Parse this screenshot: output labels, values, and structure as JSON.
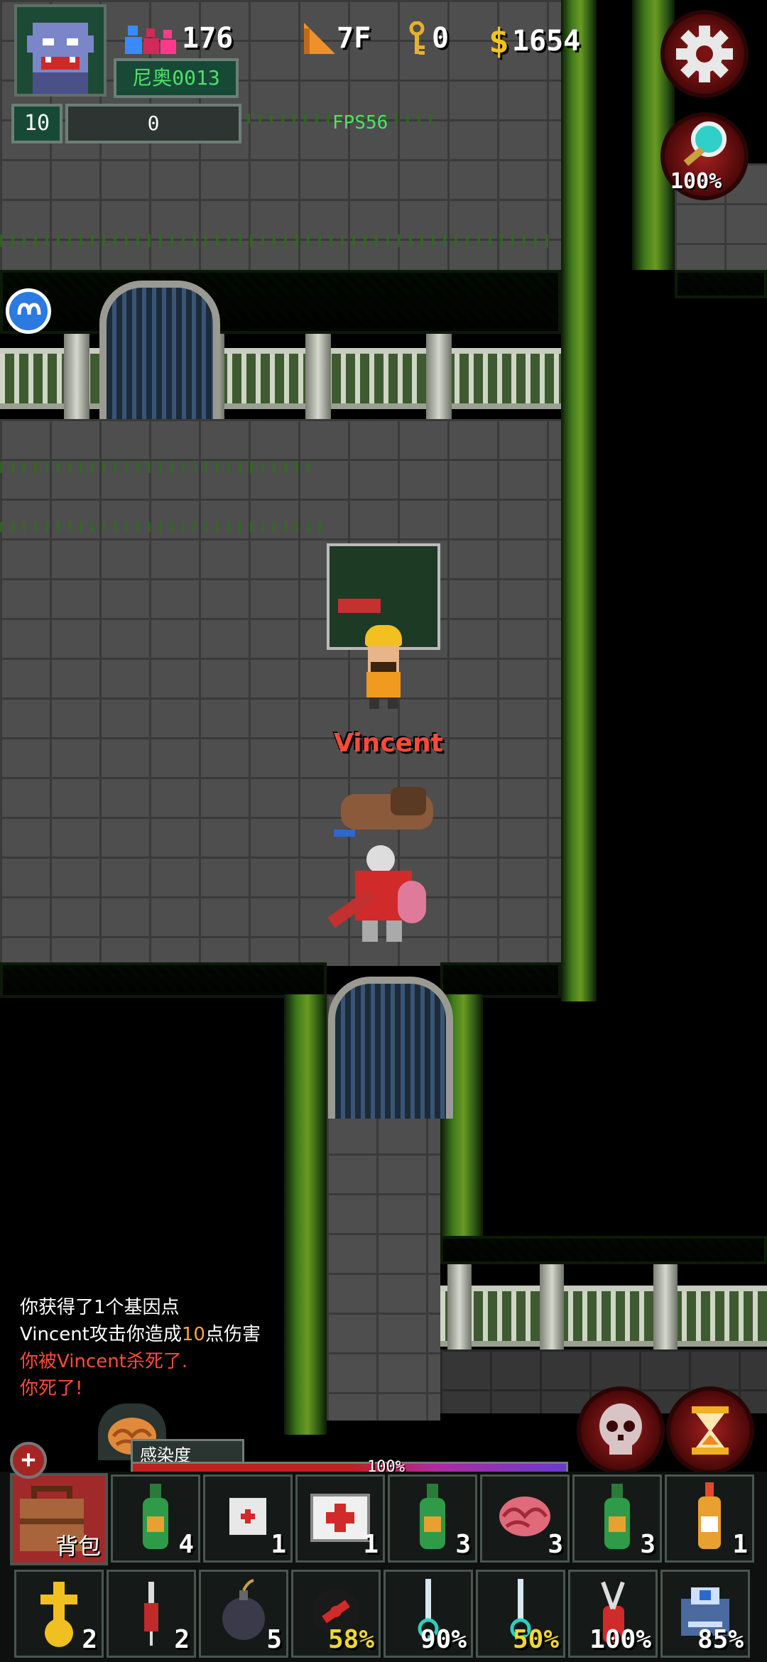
{
  "hud": {
    "population": "176",
    "floor": "7F",
    "keys": "0",
    "money": "1654",
    "player_name": "尼奥0013",
    "level": "10",
    "exp": "0",
    "fps": "FPS56",
    "search_percent": "100%"
  },
  "scene": {
    "npc_name": "Vincent"
  },
  "log": [
    {
      "text": "你获得了1个基因点",
      "color": "#ffffff"
    },
    {
      "prefix": "Vincent攻击你造成",
      "number": "10",
      "suffix": "点伤害",
      "color": "#ffffff",
      "number_color": "#f3a742"
    },
    {
      "text": "你被Vincent杀死了.",
      "color": "#ff4a3a"
    },
    {
      "text": "你死了!",
      "color": "#ff4a3a"
    }
  ],
  "infection": {
    "label": "感染度",
    "percent_text": "100%",
    "level": 1.0
  },
  "backpack_label": "背包",
  "inventory_row1": [
    {
      "icon": "green-bottle-icon",
      "qty": "4"
    },
    {
      "icon": "bandage-icon",
      "qty": "1"
    },
    {
      "icon": "medkit-icon",
      "qty": "1"
    },
    {
      "icon": "green-bottle-icon",
      "qty": "3"
    },
    {
      "icon": "brain-icon",
      "qty": "3"
    },
    {
      "icon": "green-bottle-icon",
      "qty": "3"
    },
    {
      "icon": "molotov-icon",
      "qty": "1"
    }
  ],
  "inventory_row2": [
    {
      "icon": "holy-cross-icon",
      "qty": "2",
      "yellow": false
    },
    {
      "icon": "syringe-icon",
      "qty": "2",
      "yellow": false
    },
    {
      "icon": "bomb-icon",
      "qty": "5",
      "yellow": false
    },
    {
      "icon": "mine-icon",
      "qty": "58%",
      "yellow": true
    },
    {
      "icon": "knife-icon",
      "qty": "90%",
      "yellow": false
    },
    {
      "icon": "knife-icon",
      "qty": "50%",
      "yellow": true
    },
    {
      "icon": "swiss-knife-icon",
      "qty": "100%",
      "yellow": false
    },
    {
      "icon": "printer-icon",
      "qty": "85%",
      "yellow": false
    }
  ]
}
